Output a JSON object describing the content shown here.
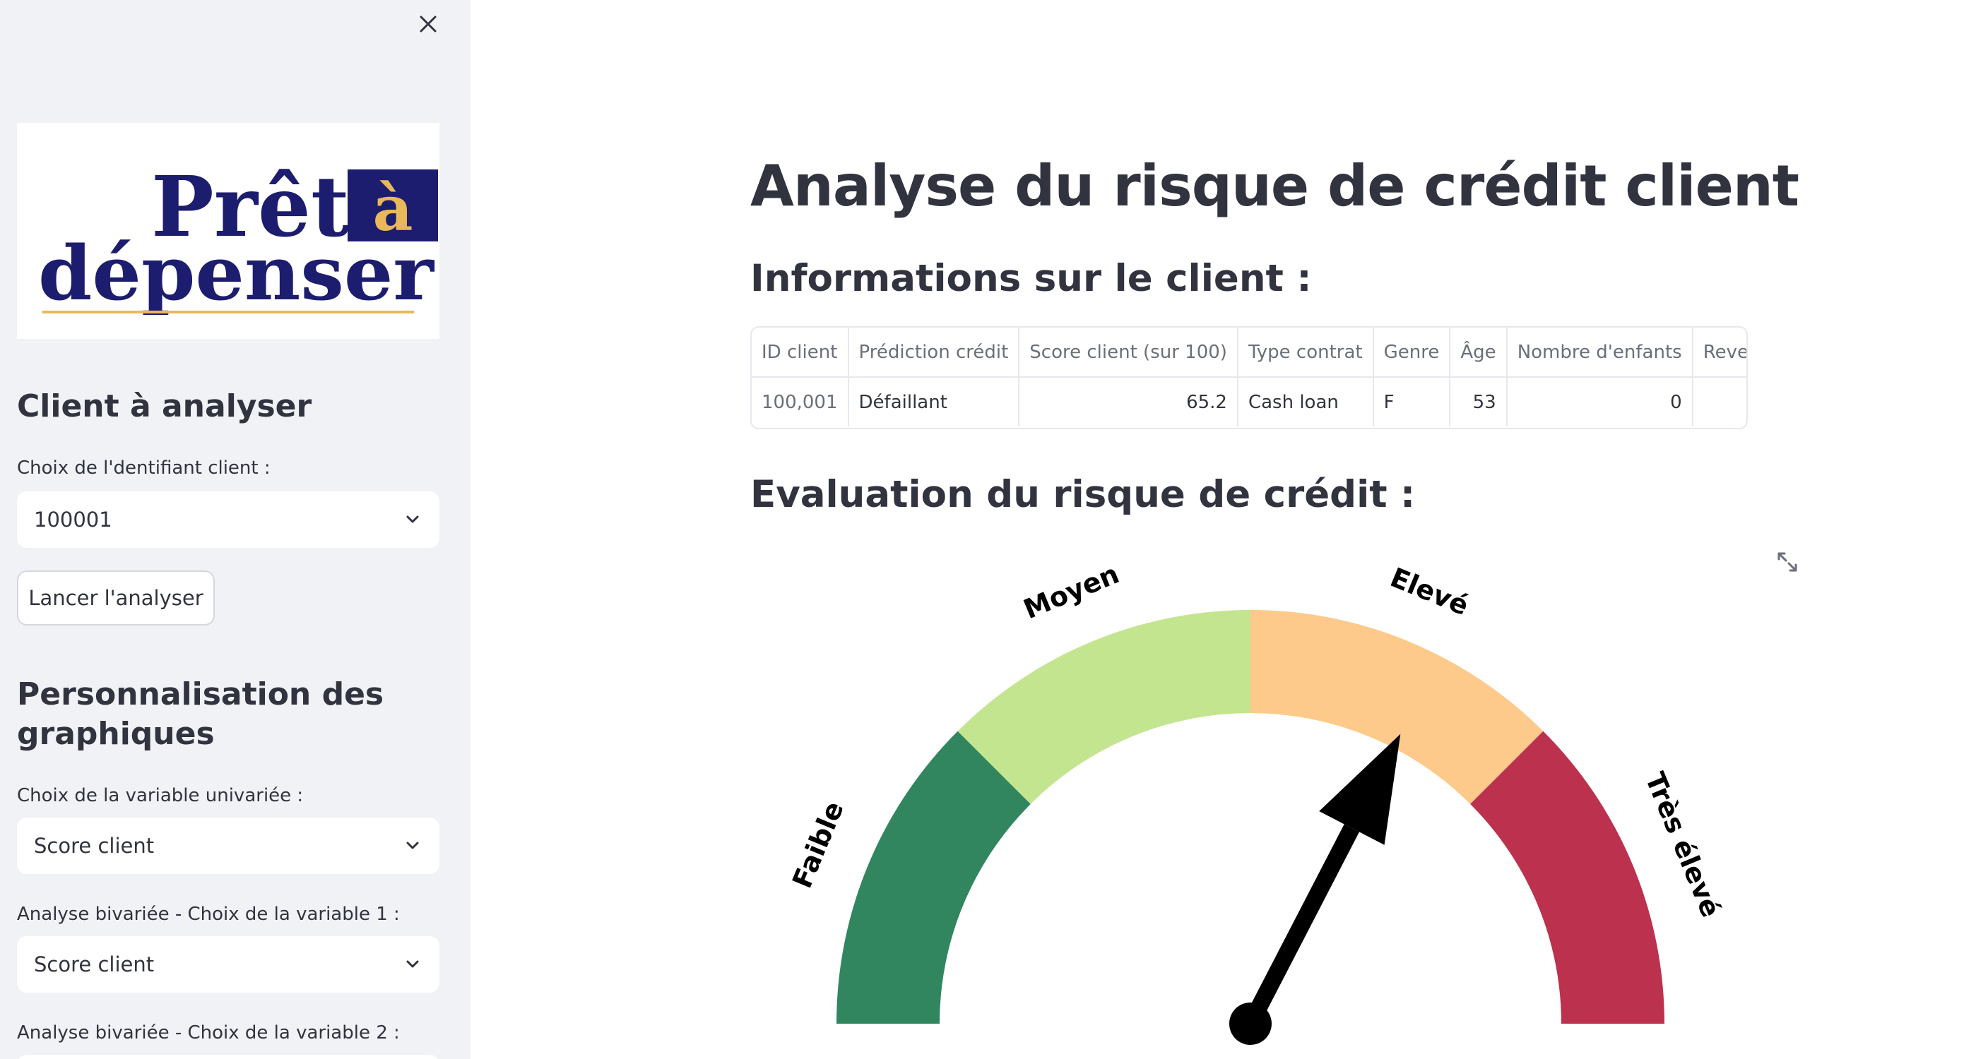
{
  "sidebar": {
    "logo": {
      "line1": "Prêt",
      "badge": "à",
      "line2": "dépenser"
    },
    "section1_title": "Client à analyser",
    "client_id_label": "Choix de l'dentifiant client :",
    "client_id_value": "100001",
    "launch_button": "Lancer l'analyser",
    "section2_title_line1": "Personnalisation des",
    "section2_title_line2": "graphiques",
    "univariate_label": "Choix de la variable univariée :",
    "univariate_value": "Score client",
    "bivariate1_label": "Analyse bivariée - Choix de la variable 1 :",
    "bivariate1_value": "Score client",
    "bivariate2_label": "Analyse bivariée - Choix de la variable 2 :"
  },
  "main": {
    "title": "Analyse du risque de crédit client",
    "client_info_title": "Informations sur le client :",
    "risk_title": "Evaluation du risque de crédit :"
  },
  "table": {
    "headers": [
      "ID client",
      "Prédiction crédit",
      "Score client (sur 100)",
      "Type contrat",
      "Genre",
      "Âge",
      "Nombre d'enfants",
      "Revenu an"
    ],
    "row": [
      "100,001",
      "Défaillant",
      "65.2",
      "Cash loan",
      "F",
      "53",
      "0",
      ""
    ]
  },
  "gauge": {
    "score": 65.2,
    "range": [
      0,
      100
    ],
    "bands": [
      {
        "label": "Faible",
        "from": 0,
        "to": 25,
        "color": "#318660"
      },
      {
        "label": "Moyen",
        "from": 25,
        "to": 50,
        "color": "#c4e590"
      },
      {
        "label": "Elevé",
        "from": 50,
        "to": 75,
        "color": "#fdca8c"
      },
      {
        "label": "Très élevé",
        "from": 75,
        "to": 100,
        "color": "#bc314d"
      }
    ]
  },
  "colors": {
    "sidebar_bg": "#f0f2f6",
    "text": "#31333f",
    "logo_navy": "#1c1d6e",
    "logo_gold": "#e9b85a"
  },
  "icons": {
    "close": "close-icon",
    "chevron": "chevron-down-icon",
    "expand": "expand-icon"
  }
}
